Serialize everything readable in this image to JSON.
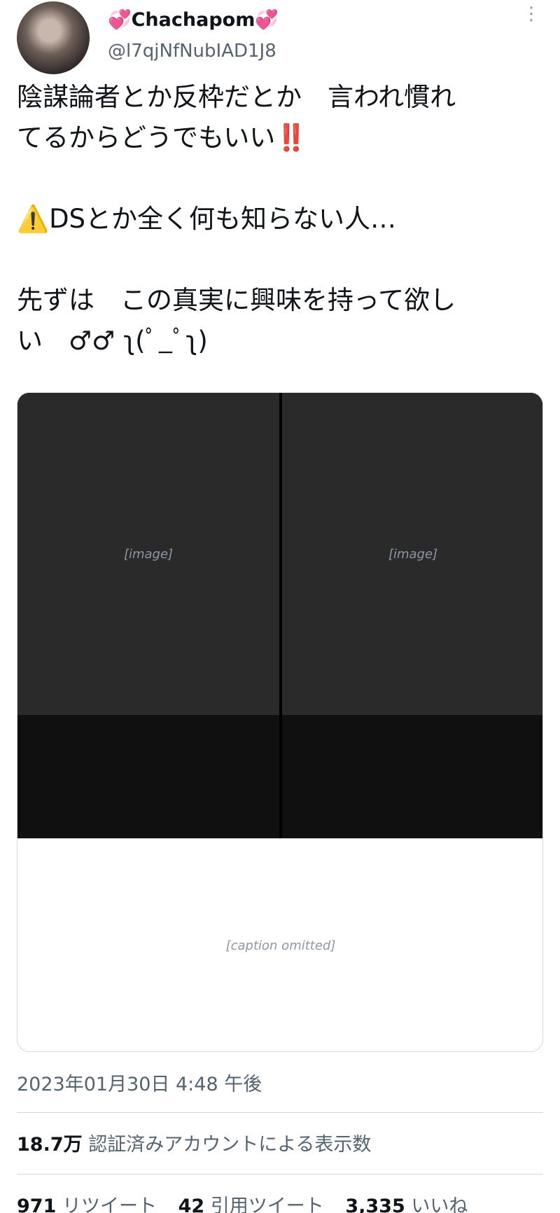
{
  "header": {
    "display_name": "💞Chachapom💞",
    "handle": "@l7qjNfNubIAD1J8",
    "more_icon": "⋮"
  },
  "tweet": {
    "lines": [
      "陰謀論者とか反枠だとか　言われ慣れ\nてるからどうでもいい‼️",
      "⚠️DSとか全く何も知らない人…",
      "先ずは　この真実に興味を持って欲し\nい　♂♂ ʅ(ﾟ_ﾟʅ)"
    ]
  },
  "media": {
    "left_placeholder": "[image]",
    "right_placeholder": "[image]",
    "caption_placeholder": "[caption omitted]"
  },
  "meta": {
    "timestamp": "2023年01月30日 4:48 午後",
    "views_count": "18.7万",
    "views_label": "認証済みアカウントによる表示数",
    "retweets_count": "971",
    "retweets_label": "リツイート",
    "quotes_count": "42",
    "quotes_label": "引用ツイート",
    "likes_count": "3,335",
    "likes_label": "いいね"
  }
}
